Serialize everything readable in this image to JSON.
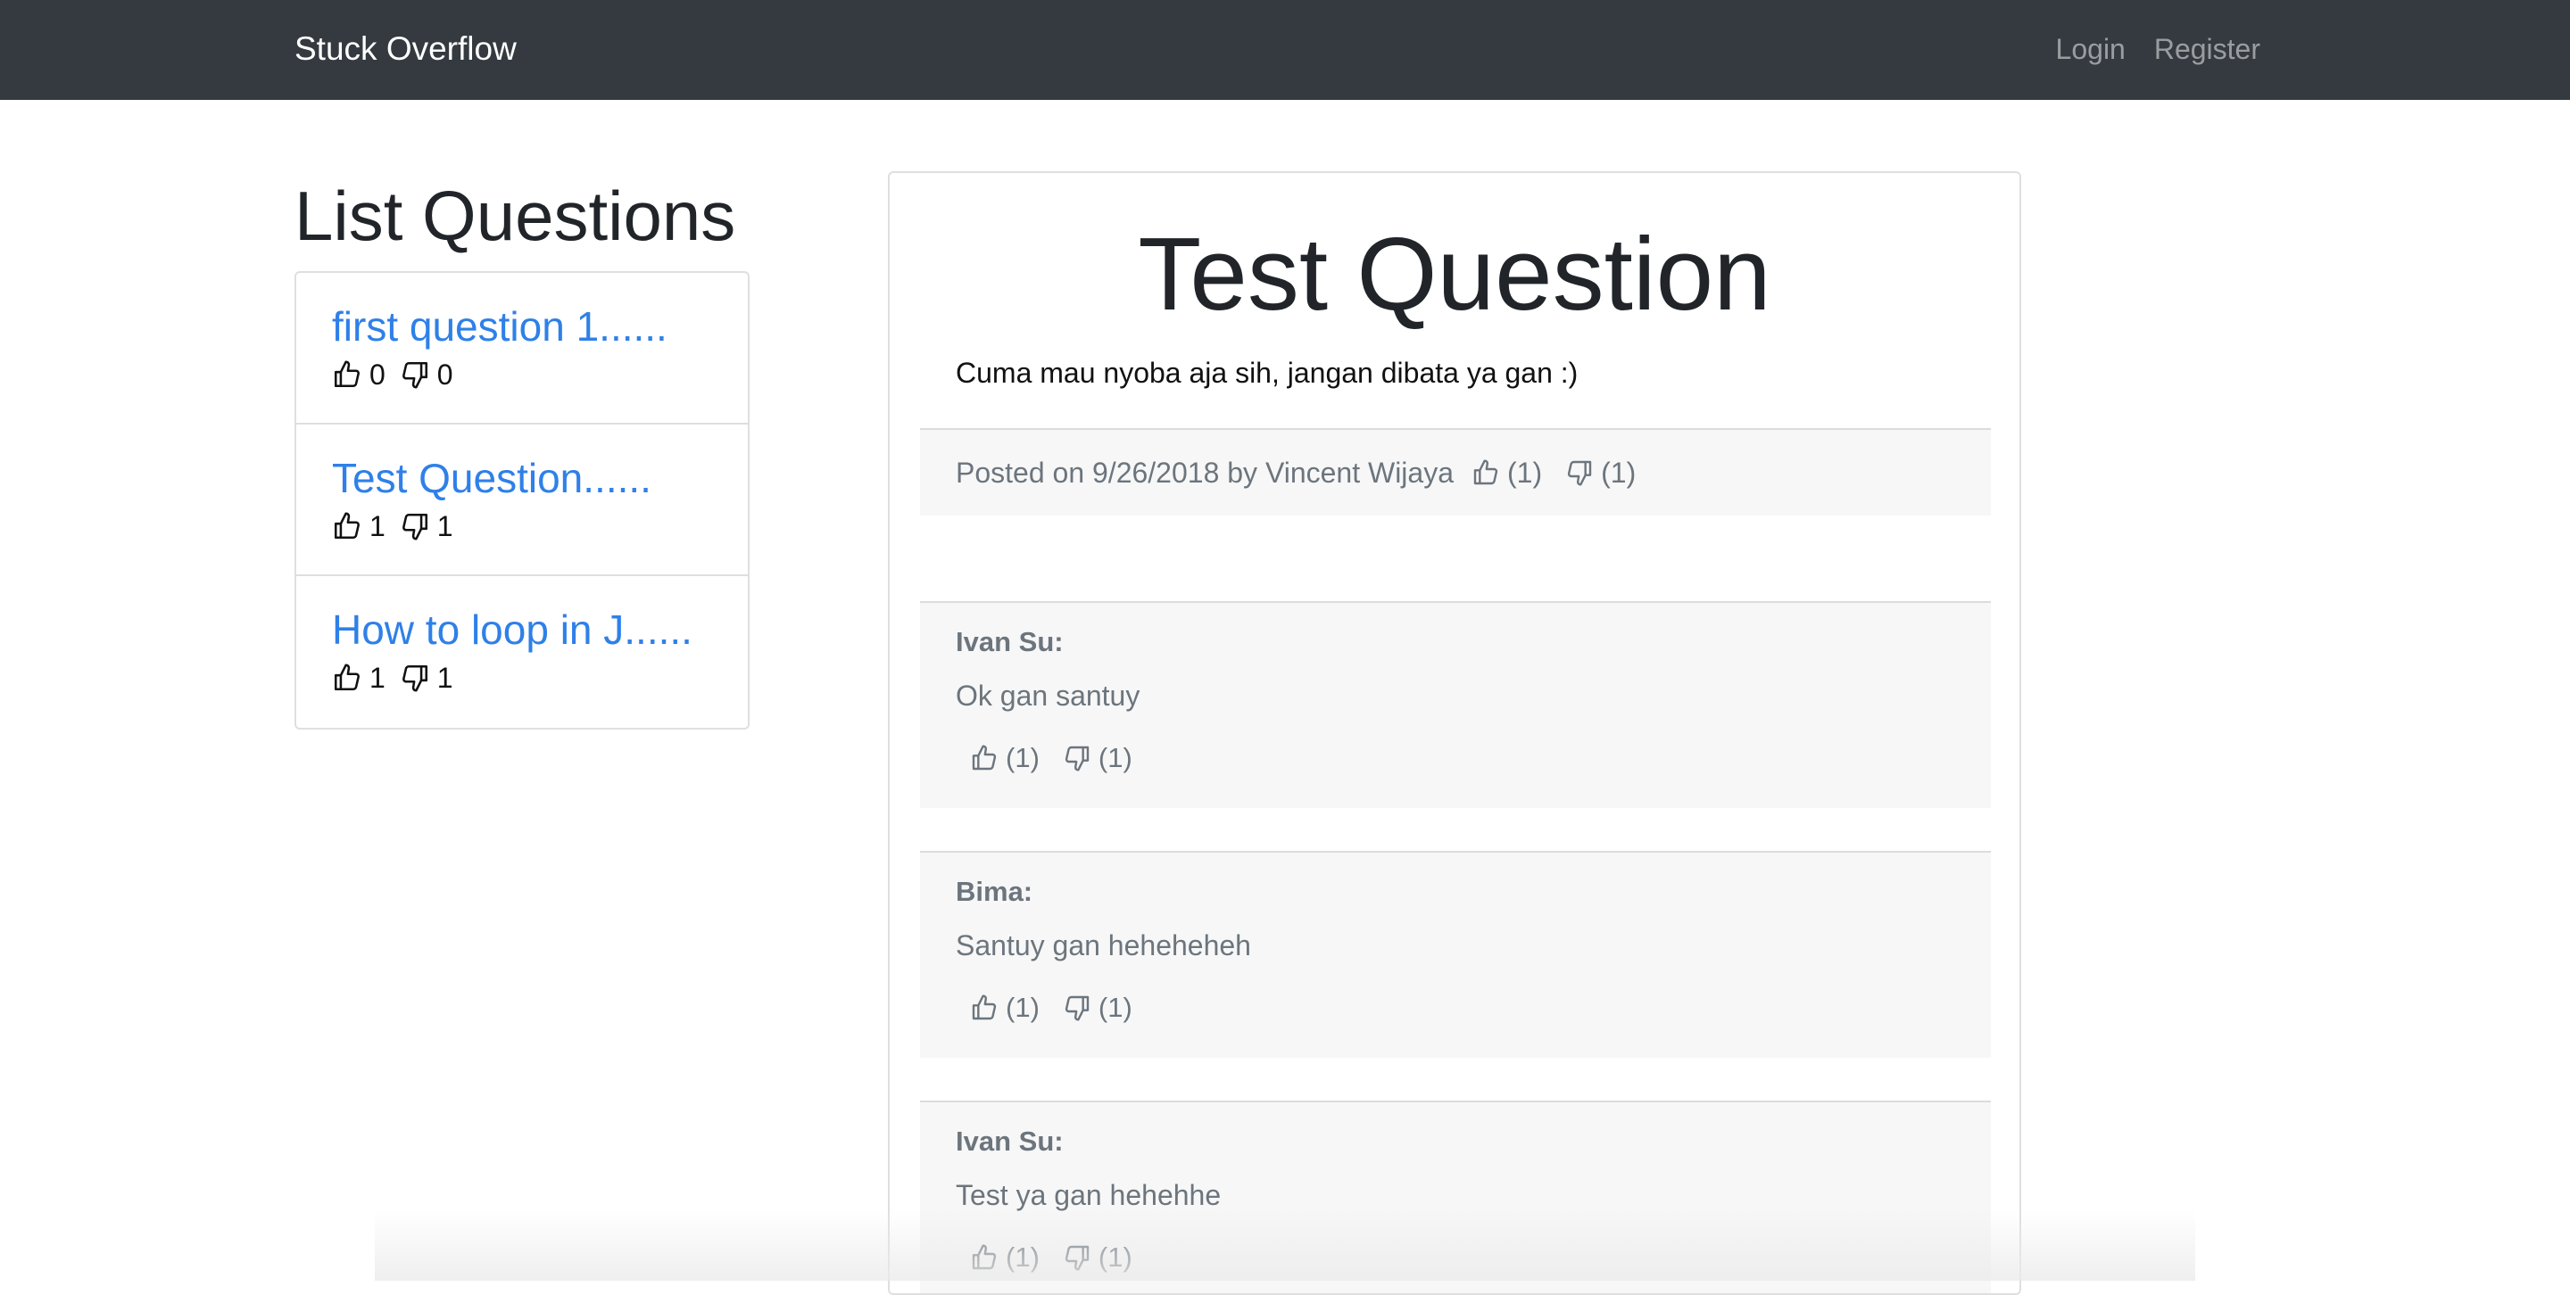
{
  "navbar": {
    "brand": "Stuck Overflow",
    "links": [
      "Login",
      "Register"
    ]
  },
  "sidebar": {
    "title": "List Questions",
    "questions": [
      {
        "title": "first question 1......",
        "likes": "0",
        "dislikes": "0"
      },
      {
        "title": "Test Question......",
        "likes": "1",
        "dislikes": "1"
      },
      {
        "title": "How to loop in J......",
        "likes": "1",
        "dislikes": "1"
      }
    ]
  },
  "question": {
    "title": "Test Question",
    "body": "Cuma mau nyoba aja sih, jangan dibata ya gan :)",
    "posted": "Posted on 9/26/2018 by Vincent Wijaya",
    "likes": "(1)",
    "dislikes": "(1)"
  },
  "answers": [
    {
      "author": "Ivan Su:",
      "text": "Ok gan santuy",
      "likes": "(1)",
      "dislikes": "(1)"
    },
    {
      "author": "Bima:",
      "text": "Santuy gan heheheheh",
      "likes": "(1)",
      "dislikes": "(1)"
    },
    {
      "author": "Ivan Su:",
      "text": "Test ya gan hehehhe",
      "likes": "(1)",
      "dislikes": "(1)"
    }
  ],
  "icons": {
    "like": "thumbs-up-icon",
    "dislike": "thumbs-down-icon"
  },
  "colors": {
    "navbar": "#343a40",
    "link": "#2f80e8",
    "muted": "#6c757d"
  }
}
